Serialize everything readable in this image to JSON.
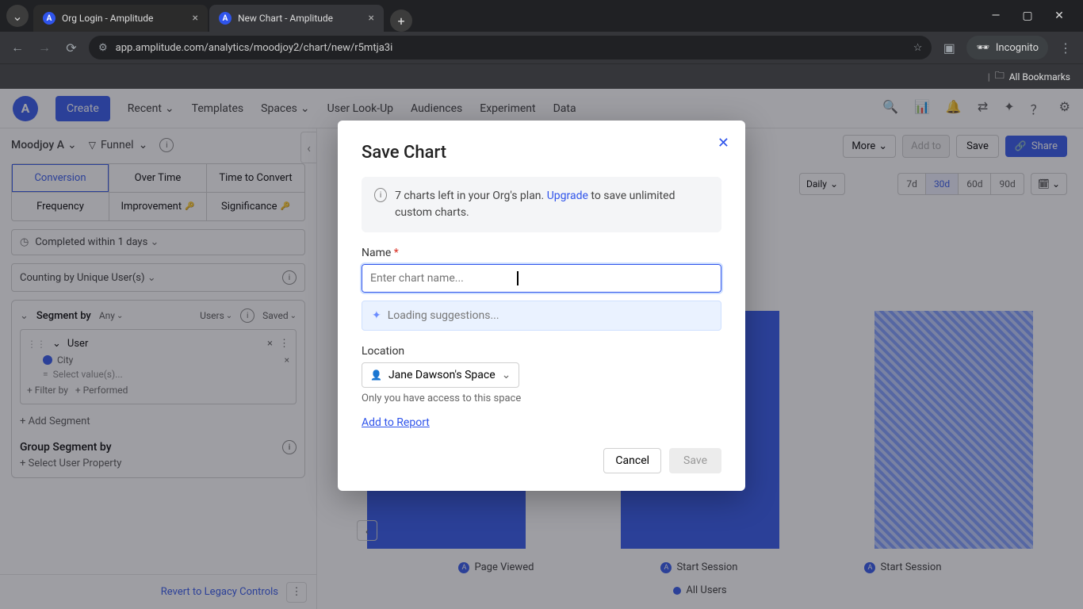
{
  "browser": {
    "tabs": [
      {
        "title": "Org Login - Amplitude"
      },
      {
        "title": "New Chart - Amplitude"
      }
    ],
    "url": "app.amplitude.com/analytics/moodjoy2/chart/new/r5mtja3i",
    "incognito": "Incognito",
    "all_bookmarks": "All Bookmarks"
  },
  "topnav": {
    "create": "Create",
    "items": [
      "Recent",
      "Templates",
      "Spaces",
      "User Look-Up",
      "Audiences",
      "Experiment",
      "Data"
    ]
  },
  "sidebar": {
    "org": "Moodjoy A",
    "chart_type": "Funnel",
    "tab_grid": {
      "r1": [
        "Conversion",
        "Over Time",
        "Time to Convert"
      ],
      "r2": [
        "Frequency",
        "Improvement",
        "Significance"
      ]
    },
    "completed": "Completed within 1 days",
    "counting": "Counting by Unique User(s)",
    "segment": {
      "title": "Segment by",
      "any": "Any",
      "users": "Users",
      "saved": "Saved",
      "user": "User",
      "prop": "City",
      "eq": "=",
      "value_ph": "Select value(s)...",
      "filter": "+ Filter by",
      "performed": "+ Performed",
      "add": "+ Add Segment",
      "group": "Group Segment by",
      "select_prop": "+ Select User Property"
    },
    "revert": "Revert to Legacy Controls"
  },
  "toolbar": {
    "more": "More",
    "addto": "Add to",
    "save": "Save",
    "share": "Share",
    "daily": "Daily",
    "ranges": [
      "7d",
      "30d",
      "60d",
      "90d"
    ]
  },
  "chart": {
    "xlabels": [
      "Page Viewed",
      "Start Session",
      "Start Session"
    ],
    "legend": "All Users"
  },
  "modal": {
    "title": "Save Chart",
    "notice_pre": "7 charts left in your Org's plan. ",
    "notice_link": "Upgrade",
    "notice_post": " to save unlimited custom charts.",
    "name_label": "Name",
    "name_ph": "Enter chart name...",
    "suggest": "Loading suggestions...",
    "loc_label": "Location",
    "loc_value": "Jane Dawson's Space",
    "loc_hint": "Only you have access to this space",
    "add_report": "Add to Report",
    "cancel": "Cancel",
    "save": "Save"
  }
}
